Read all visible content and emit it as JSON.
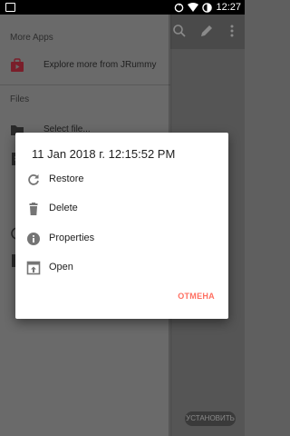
{
  "status_bar": {
    "time": "12:27",
    "icons": [
      "image-notification-icon",
      "sync-icon",
      "wifi-icon",
      "battery-icon"
    ]
  },
  "app_toolbar": {
    "icons": [
      "search-icon",
      "edit-icon",
      "more-vert-icon"
    ]
  },
  "drawer": {
    "more_apps_label": "More Apps",
    "explore_label": "Explore more from JRummy",
    "files_label": "Files",
    "select_file_label": "Select file..."
  },
  "install_button": "УСТАНОВИТЬ",
  "dialog": {
    "title": "11 Jan 2018 г. 12:15:52 PM",
    "options": [
      {
        "label": "Restore",
        "icon": "restore-icon"
      },
      {
        "label": "Delete",
        "icon": "delete-icon"
      },
      {
        "label": "Properties",
        "icon": "info-icon"
      },
      {
        "label": "Open",
        "icon": "open-in-new-icon"
      }
    ],
    "cancel": "ОТМЕНА"
  },
  "colors": {
    "accent": "#ff6f61",
    "drawer_bg": "#6a6a6a",
    "dialog_bg": "#ffffff"
  }
}
